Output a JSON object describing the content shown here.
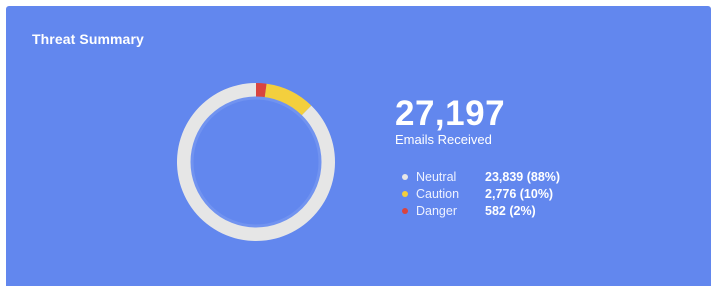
{
  "card": {
    "title": "Threat Summary",
    "background": "#6287ee"
  },
  "summary": {
    "total": "27,197",
    "total_label": "Emails Received"
  },
  "legend": [
    {
      "name": "Neutral",
      "value": "23,839 (88%)",
      "color": "#e6e6e6"
    },
    {
      "name": "Caution",
      "value": "2,776 (10%)",
      "color": "#f3cf3d"
    },
    {
      "name": "Danger",
      "value": "582 (2%)",
      "color": "#d9443f"
    }
  ],
  "chart_data": {
    "type": "pie",
    "style": "donut",
    "categories": [
      "Neutral",
      "Caution",
      "Danger"
    ],
    "values": [
      23839,
      2776,
      582
    ],
    "colors": [
      "#e6e6e6",
      "#f3cf3d",
      "#d9443f"
    ],
    "start": "top, clockwise, Danger then Caution then Neutral"
  }
}
